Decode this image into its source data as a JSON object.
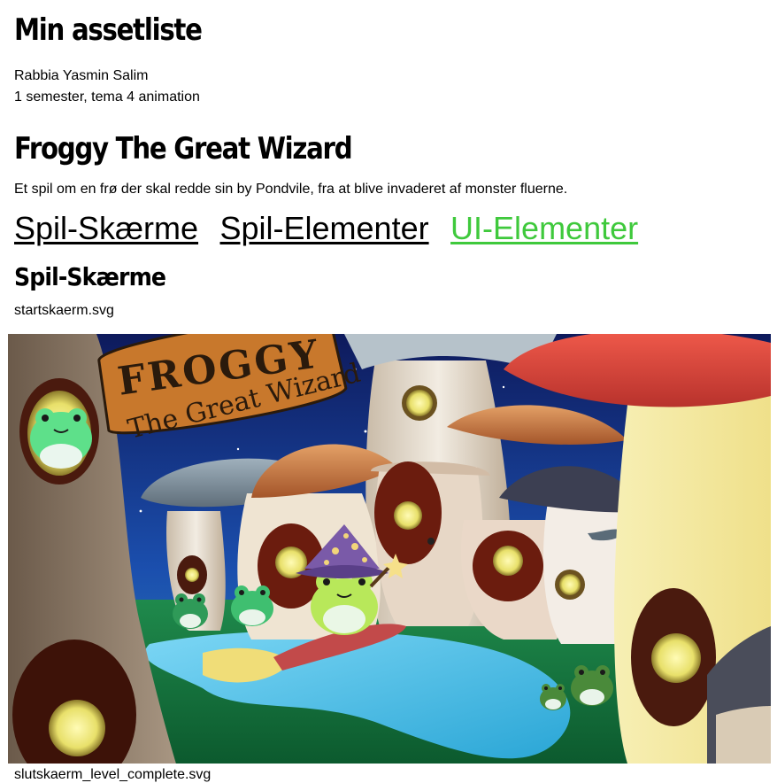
{
  "page": {
    "title": "Min assetliste",
    "author": "Rabbia Yasmin Salim",
    "course": "1 semester, tema 4 animation"
  },
  "game": {
    "title": "Froggy The Great Wizard",
    "description": "Et spil om en frø der skal redde sin by Pondvile, fra at blive invaderet af monster fluerne."
  },
  "nav": {
    "tabs": [
      {
        "label": "Spil-Skærme",
        "active": false
      },
      {
        "label": "Spil-Elementer",
        "active": false
      },
      {
        "label": "UI-Elementer",
        "active": true
      }
    ]
  },
  "section": {
    "title": "Spil-Skærme",
    "files": [
      "startskaerm.svg",
      "slutskaerm_level_complete.svg"
    ]
  },
  "artwork": {
    "sign_line1": "FROGGY",
    "sign_line2": "The Great Wizard"
  },
  "colors": {
    "active_link": "#3fc93c"
  }
}
